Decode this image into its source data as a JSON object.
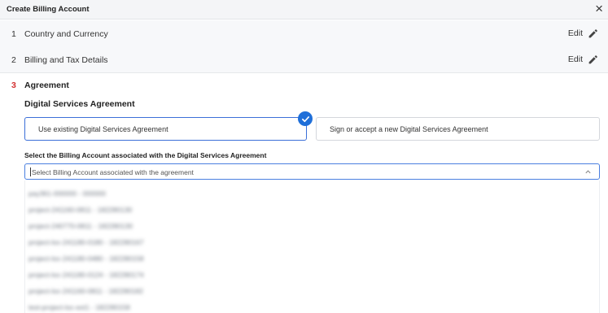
{
  "dialog": {
    "title": "Create Billing Account",
    "close_symbol": "×"
  },
  "steps": [
    {
      "number": "1",
      "label": "Country and Currency",
      "edit_label": "Edit"
    },
    {
      "number": "2",
      "label": "Billing and Tax Details",
      "edit_label": "Edit"
    },
    {
      "number": "3",
      "label": "Agreement"
    }
  ],
  "agreement": {
    "section_title": "Digital Services Agreement",
    "options": [
      {
        "label": "Use existing Digital Services Agreement",
        "selected": true
      },
      {
        "label": "Sign or accept a new Digital Services Agreement",
        "selected": false
      }
    ],
    "select_label": "Select the Billing Account associated with the Digital Services Agreement",
    "select_placeholder": "Select Billing Account associated with the agreement",
    "dropdown_items": [
      "pay361-000000 - 000000",
      "project-241160-0811 - 182280130",
      "project-240770-0811 - 182280130",
      "project-loc-241180-0180 - 182280167",
      "project-loc-241180-0480 - 182280158",
      "project-loc-241180-0124 - 182280174",
      "project-loc-241160-0811 - 182280182",
      "test-project-loc-ext1 - 182280158"
    ]
  },
  "colors": {
    "accent": "#1f6fd9",
    "step_active": "#d32f2f"
  }
}
